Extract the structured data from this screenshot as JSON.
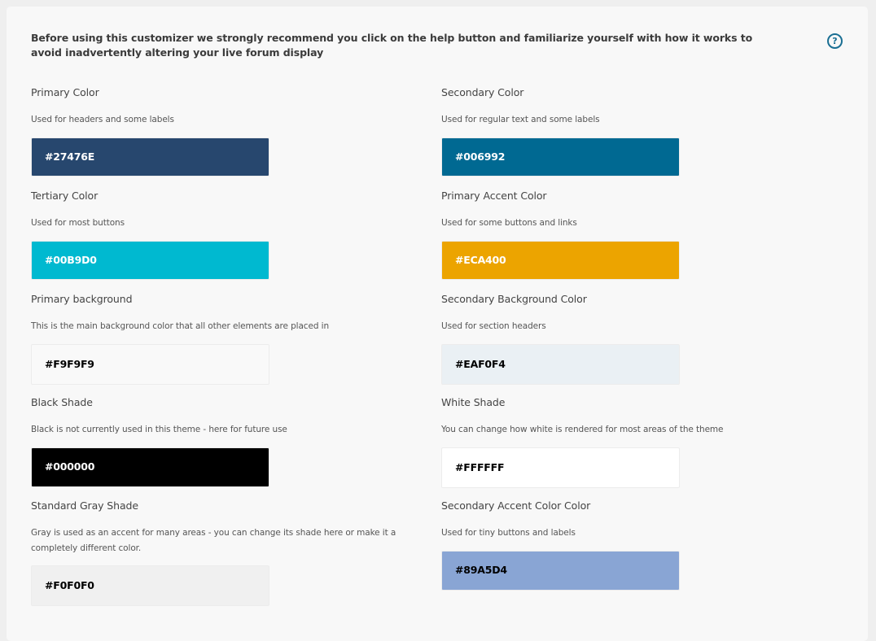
{
  "notice": "Before using this customizer we strongly recommend you click on the help button and familiarize yourself with how it works to avoid inadvertently altering your live forum display",
  "help_button": {
    "icon": "question-circle-icon",
    "symbol": "?",
    "color": "#1A6F93"
  },
  "fields": [
    {
      "title": "Primary Color",
      "description": "Used for headers and some labels",
      "value": "#27476E",
      "text_color": "#FFFFFF"
    },
    {
      "title": "Secondary Color",
      "description": "Used for regular text and some labels",
      "value": "#006992",
      "text_color": "#FFFFFF"
    },
    {
      "title": "Tertiary Color",
      "description": "Used for most buttons",
      "value": "#00B9D0",
      "text_color": "#FFFFFF"
    },
    {
      "title": "Primary Accent Color",
      "description": "Used for some buttons and links",
      "value": "#ECA400",
      "text_color": "#FFFFFF"
    },
    {
      "title": "Primary background",
      "description": "This is the main background color that all other elements are placed in",
      "value": "#F9F9F9",
      "text_color": "#000000"
    },
    {
      "title": "Secondary Background Color",
      "description": "Used for section headers",
      "value": "#EAF0F4",
      "text_color": "#000000"
    },
    {
      "title": "Black Shade",
      "description": "Black is not currently used in this theme - here for future use",
      "value": "#000000",
      "text_color": "#FFFFFF"
    },
    {
      "title": "White Shade",
      "description": "You can change how white is rendered for most areas of the theme",
      "value": "#FFFFFF",
      "text_color": "#000000"
    },
    {
      "title": "Standard Gray Shade",
      "description": "Gray is used as an accent for many areas - you can change its shade here or make it a completely different color.",
      "value": "#F0F0F0",
      "text_color": "#000000"
    },
    {
      "title": "Secondary Accent Color Color",
      "description": "Used for tiny buttons and labels",
      "value": "#89A5D4",
      "text_color": "#000000"
    }
  ]
}
